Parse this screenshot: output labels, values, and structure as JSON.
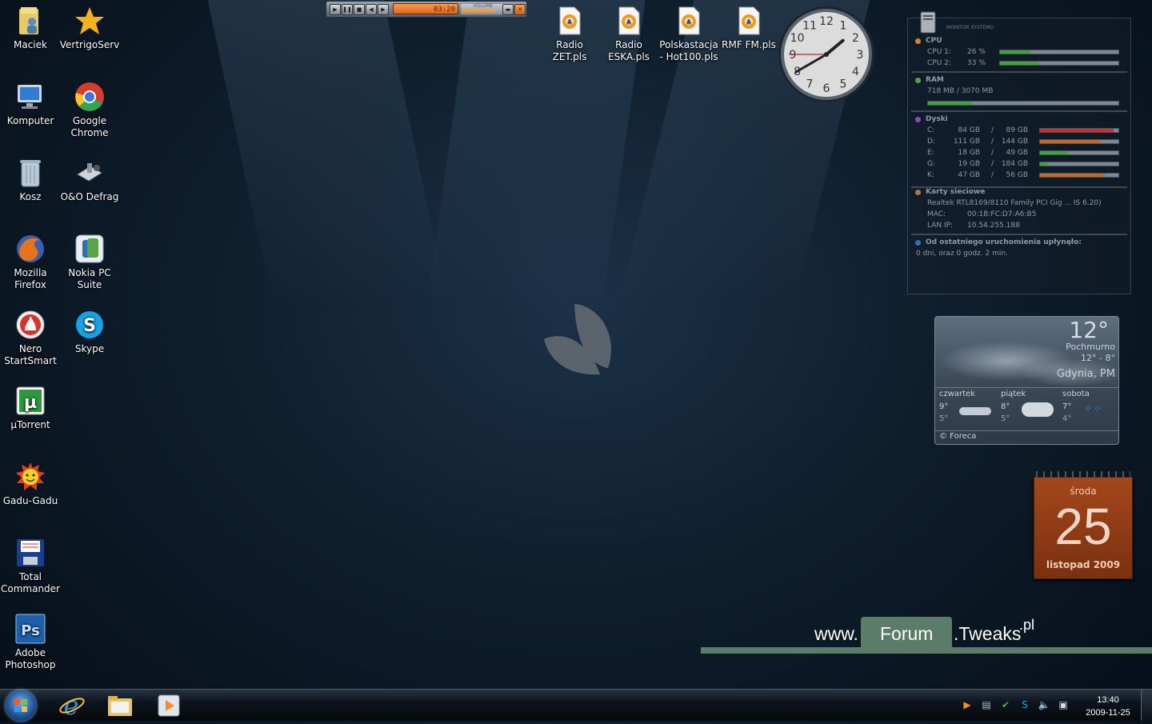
{
  "desktop_icons": [
    {
      "label": "Maciek",
      "icon": "user-folder-icon"
    },
    {
      "label": "VertrigoServ",
      "icon": "star-icon"
    },
    {
      "label": "Komputer",
      "icon": "computer-icon"
    },
    {
      "label": "Google Chrome",
      "icon": "chrome-icon"
    },
    {
      "label": "Kosz",
      "icon": "recycle-bin-icon"
    },
    {
      "label": "O&O Defrag",
      "icon": "defrag-icon"
    },
    {
      "label": "Mozilla Firefox",
      "icon": "firefox-icon"
    },
    {
      "label": "Nokia PC Suite",
      "icon": "nokia-suite-icon"
    },
    {
      "label": "Nero StartSmart",
      "icon": "nero-icon"
    },
    {
      "label": "Skype",
      "icon": "skype-icon"
    },
    {
      "label": "µTorrent",
      "icon": "utorrent-icon"
    },
    {
      "label": "Gadu-Gadu",
      "icon": "gadu-gadu-icon"
    },
    {
      "label": "Total Commander",
      "icon": "floppy-icon"
    },
    {
      "label": "Adobe Photoshop",
      "icon": "photoshop-icon"
    }
  ],
  "playlist_icons": [
    {
      "label": "Radio ZET.pls"
    },
    {
      "label": "Radio ESKA.pls"
    },
    {
      "label": "Polskastacja - Hot100.pls"
    },
    {
      "label": "RMF FM.pls"
    }
  ],
  "player": {
    "time": "03:20",
    "volume_label": "VOLUME",
    "volume": 0.8
  },
  "clock_gadget": {
    "hour": 1,
    "minute": 40,
    "second": 45
  },
  "monitor": {
    "title": "MONITOR SYSTEMU",
    "cpu": {
      "title": "CPU",
      "rows": [
        {
          "name": "CPU 1:",
          "value": "26 %",
          "fill": 0.26
        },
        {
          "name": "CPU 2:",
          "value": "33 %",
          "fill": 0.33
        }
      ]
    },
    "ram": {
      "title": "RAM",
      "text": "718 MB / 3070 MB",
      "fill": 0.23
    },
    "disks": {
      "title": "Dyski",
      "rows": [
        {
          "drive": "C:",
          "used": "84 GB",
          "sep": "/",
          "total": "89 GB",
          "fill": 0.94,
          "color": "#c9302b"
        },
        {
          "drive": "D:",
          "used": "111 GB",
          "sep": "/",
          "total": "144 GB",
          "fill": 0.77,
          "color": "#c56a22"
        },
        {
          "drive": "E:",
          "used": "18 GB",
          "sep": "/",
          "total": "49 GB",
          "fill": 0.37,
          "color": "#3fa33c"
        },
        {
          "drive": "G:",
          "used": "19 GB",
          "sep": "/",
          "total": "184 GB",
          "fill": 0.1,
          "color": "#3fa33c"
        },
        {
          "drive": "K:",
          "used": "47 GB",
          "sep": "/",
          "total": "56 GB",
          "fill": 0.84,
          "color": "#c56a22"
        }
      ]
    },
    "network": {
      "title": "Karty sieciowe",
      "adapter": "Realtek RTL8169/8110 Family PCI Gig ... IS 6.20)",
      "mac_label": "MAC:",
      "mac": "00:1B:FC:D7:A6:B5",
      "ip_label": "LAN IP:",
      "ip": "10.54.255.188"
    },
    "uptime": {
      "title": "Od ostatniego uruchomienia upłynęło:",
      "text": "0 dni, oraz 0 godz. 2 min."
    }
  },
  "weather": {
    "temp": "12°",
    "condition": "Pochmurno",
    "high": "12°",
    "dash": "-",
    "low": "8°",
    "location": "Gdynia, PM",
    "forecast": [
      {
        "day": "czwartek",
        "high": "9°",
        "low": "5°"
      },
      {
        "day": "piątek",
        "high": "8°",
        "low": "5°"
      },
      {
        "day": "sobota",
        "high": "7°",
        "low": "4°"
      }
    ],
    "source": "© Foreca"
  },
  "calendar": {
    "weekday": "środa",
    "day": "25",
    "month_year": "listopad 2009"
  },
  "banner": {
    "www": "www.",
    "forum": "Forum",
    "tweaks": ".Tweaks",
    "pl": ".pl"
  },
  "taskbar": {
    "items": [
      {
        "icon": "internet-explorer-icon"
      },
      {
        "icon": "explorer-folder-icon"
      },
      {
        "icon": "media-player-icon"
      }
    ],
    "time": "13:40",
    "date": "2009-11-25"
  },
  "colors": {
    "accent_green": "#5b7c68",
    "calendar": "#a4471c"
  }
}
